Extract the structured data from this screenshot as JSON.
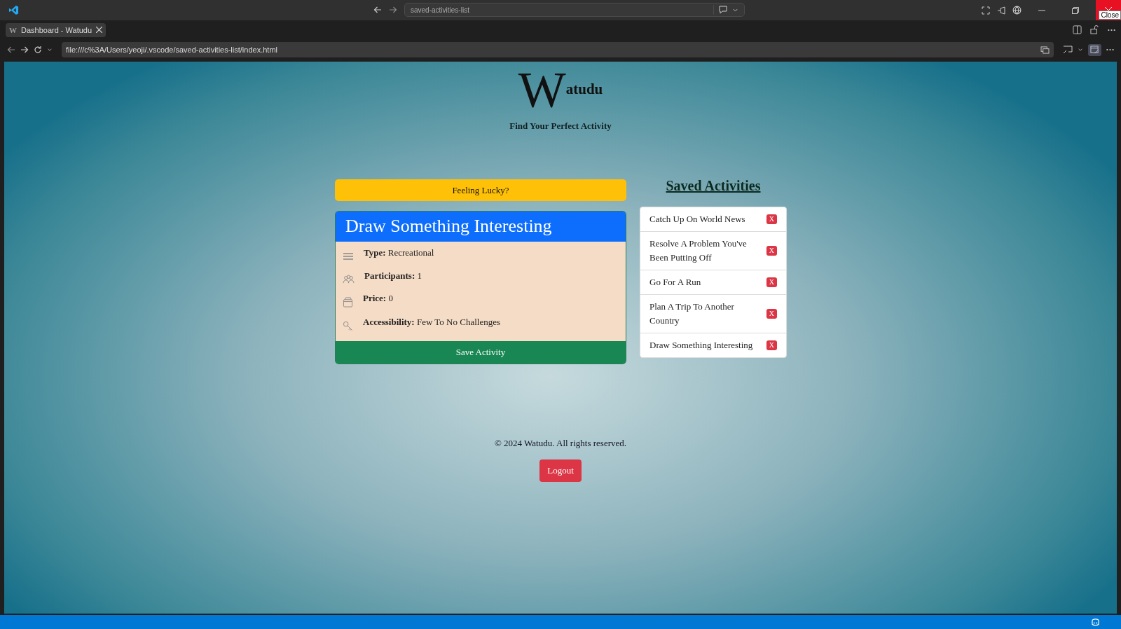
{
  "titlebar": {
    "command_center": "saved-activities-list",
    "tooltip": "Close"
  },
  "tabs": [
    {
      "favicon": "W",
      "label": "Dashboard - Watudu",
      "selected": true
    }
  ],
  "address_bar": {
    "url": "file:///c%3A/Users/yeoji/.vscode/saved-activities-list/index.html"
  },
  "page": {
    "logo": {
      "initial": "W",
      "rest": "atudu"
    },
    "tagline": "Find Your Perfect Activity",
    "lucky_button": "Feeling Lucky?",
    "activity": {
      "title": "Draw Something Interesting",
      "fields": [
        {
          "kind": "type",
          "label": "Type:",
          "value": "Recreational"
        },
        {
          "kind": "participants",
          "label": "Participants:",
          "value": "1"
        },
        {
          "kind": "price",
          "label": "Price:",
          "value": "0"
        },
        {
          "kind": "accessibility",
          "label": "Accessibility:",
          "value": "Few To No Challenges"
        }
      ],
      "save_button": "Save Activity"
    },
    "saved": {
      "title": "Saved Activities",
      "items": [
        {
          "name": "Catch Up On World News",
          "remove": "X"
        },
        {
          "name": "Resolve A Problem You've Been Putting Off",
          "remove": "X"
        },
        {
          "name": "Go For A Run",
          "remove": "X"
        },
        {
          "name": "Plan A Trip To Another Country",
          "remove": "X"
        },
        {
          "name": "Draw Something Interesting",
          "remove": "X"
        }
      ]
    },
    "footer": "© 2024 Watudu. All rights reserved.",
    "logout": "Logout"
  }
}
